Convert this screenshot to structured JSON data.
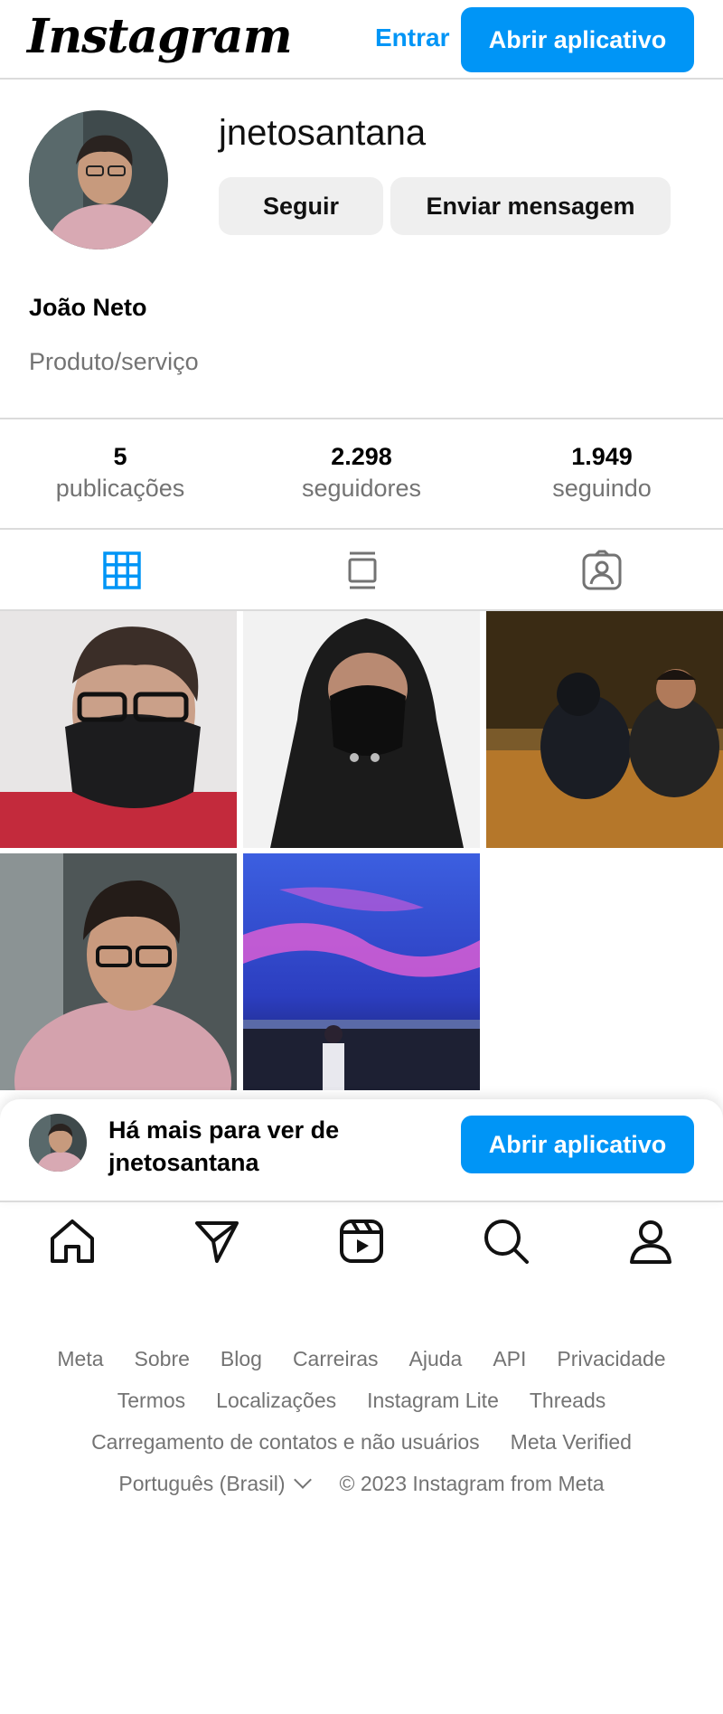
{
  "header": {
    "logo": "Instagram",
    "login_label": "Entrar",
    "open_app_label": "Abrir aplicativo"
  },
  "profile": {
    "username": "jnetosantana",
    "follow_label": "Seguir",
    "message_label": "Enviar mensagem",
    "full_name": "João Neto",
    "category": "Produto/serviço"
  },
  "stats": [
    {
      "value": "5",
      "label": "publicações"
    },
    {
      "value": "2.298",
      "label": "seguidores"
    },
    {
      "value": "1.949",
      "label": "seguindo"
    }
  ],
  "tabs": [
    "grid-tab",
    "reels-tab",
    "tagged-tab"
  ],
  "posts": [
    "photo-masked-red-shirt",
    "photo-black-hood",
    "photo-night-friends",
    "photo-pink-hoodie",
    "photo-pink-sky"
  ],
  "more_sheet": {
    "line1": "Há mais para ver de",
    "line2": "jnetosantana",
    "open_app_label": "Abrir aplicativo"
  },
  "nav": [
    "home-icon",
    "direct-icon",
    "reels-icon",
    "search-icon",
    "profile-icon"
  ],
  "footer": {
    "row1": [
      "Meta",
      "Sobre",
      "Blog",
      "Carreiras",
      "Ajuda",
      "API",
      "Privacidade"
    ],
    "row2": [
      "Termos",
      "Localizações",
      "Instagram Lite",
      "Threads"
    ],
    "row3": [
      "Carregamento de contatos e não usuários",
      "Meta Verified"
    ],
    "language": "Português (Brasil)",
    "copyright": "© 2023 Instagram from Meta"
  },
  "colors": {
    "accent": "#0095f6",
    "muted": "#737373",
    "border": "#dbdbdb",
    "button_grey": "#efefef"
  }
}
